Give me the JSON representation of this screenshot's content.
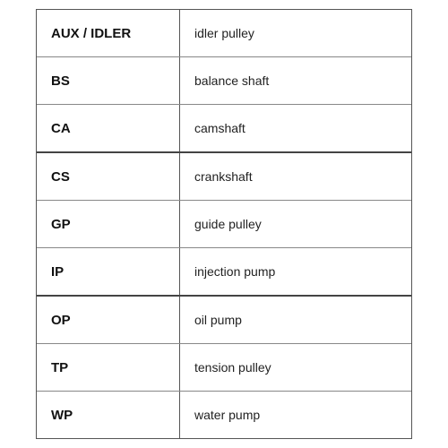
{
  "table": {
    "rows": [
      {
        "abbr": "AUX / IDLER",
        "description": "idler pulley",
        "thickBottom": false
      },
      {
        "abbr": "BS",
        "description": "balance shaft",
        "thickBottom": false
      },
      {
        "abbr": "CA",
        "description": "camshaft",
        "thickBottom": true
      },
      {
        "abbr": "CS",
        "description": "crankshaft",
        "thickBottom": false
      },
      {
        "abbr": "GP",
        "description": "guide pulley",
        "thickBottom": false
      },
      {
        "abbr": "IP",
        "description": "injection pump",
        "thickBottom": true
      },
      {
        "abbr": "OP",
        "description": "oil pump",
        "thickBottom": false
      },
      {
        "abbr": "TP",
        "description": "tension pulley",
        "thickBottom": false
      },
      {
        "abbr": "WP",
        "description": "water pump",
        "thickBottom": false
      }
    ]
  }
}
